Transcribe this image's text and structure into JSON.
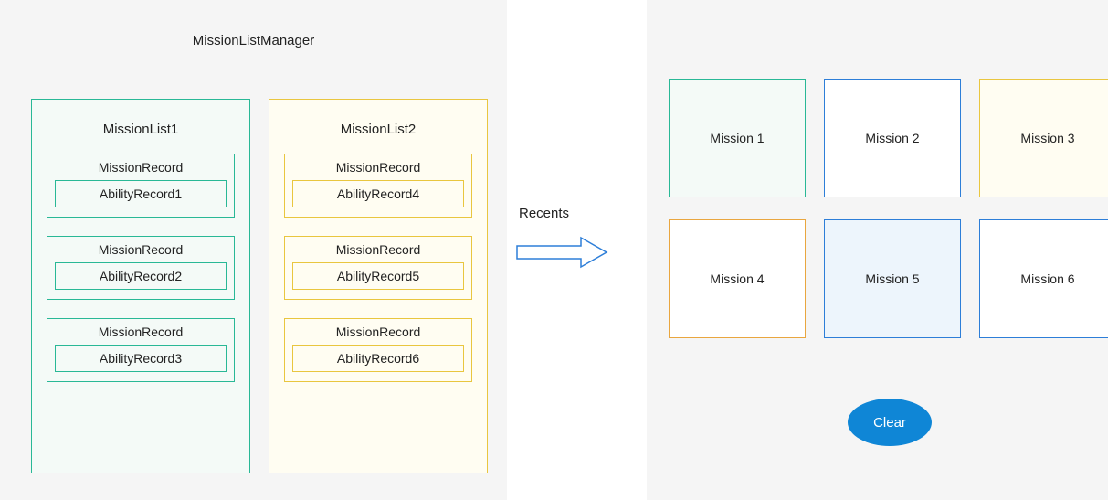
{
  "manager": {
    "title": "MissionListManager",
    "lists": [
      {
        "title": "MissionList1",
        "records": [
          {
            "record": "MissionRecord",
            "ability": "AbilityRecord1"
          },
          {
            "record": "MissionRecord",
            "ability": "AbilityRecord2"
          },
          {
            "record": "MissionRecord",
            "ability": "AbilityRecord3"
          }
        ]
      },
      {
        "title": "MissionList2",
        "records": [
          {
            "record": "MissionRecord",
            "ability": "AbilityRecord4"
          },
          {
            "record": "MissionRecord",
            "ability": "AbilityRecord5"
          },
          {
            "record": "MissionRecord",
            "ability": "AbilityRecord6"
          }
        ]
      }
    ]
  },
  "arrow": {
    "label": "Recents"
  },
  "recents": {
    "tiles": [
      {
        "label": "Mission 1"
      },
      {
        "label": "Mission 2"
      },
      {
        "label": "Mission 3"
      },
      {
        "label": "Mission 4"
      },
      {
        "label": "Mission 5"
      },
      {
        "label": "Mission 6"
      }
    ],
    "clear_label": "Clear"
  }
}
